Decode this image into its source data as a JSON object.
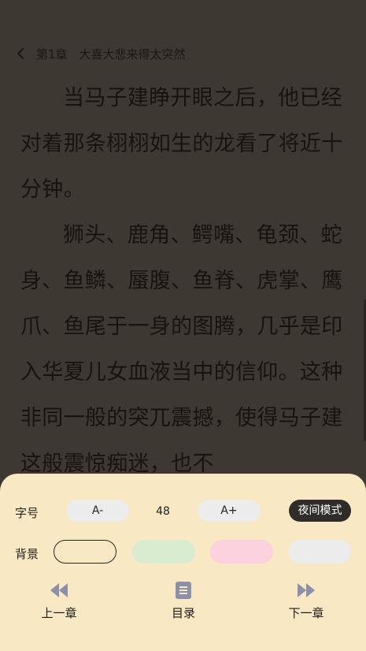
{
  "header": {
    "chapter_title": "第1章　大喜大悲来得太突然"
  },
  "content": {
    "paragraphs": [
      "当马子建睁开眼之后，他已经对着那条栩栩如生的龙看了将近十分钟。",
      "狮头、鹿角、鳄嘴、龟颈、蛇身、鱼鳞、蜃腹、鱼脊、虎掌、鹰爪、鱼尾于一身的图腾，几乎是印入华夏儿女血液当中的信仰。这种非同一般的突兀震撼，使得马子建这般震惊痴迷，也不"
    ]
  },
  "settings": {
    "font_size_label": "字号",
    "decrease_label": "A-",
    "font_size_value": "48",
    "increase_label": "A+",
    "night_mode_label": "夜间模式",
    "background_label": "背景",
    "background_swatches": [
      {
        "name": "cream",
        "color": "#f8e8c3",
        "selected": true
      },
      {
        "name": "green",
        "color": "#d9eccf",
        "selected": false
      },
      {
        "name": "pink",
        "color": "#fcd2de",
        "selected": false
      },
      {
        "name": "gray",
        "color": "#ececec",
        "selected": false
      }
    ]
  },
  "nav": {
    "prev_label": "上一章",
    "toc_label": "目录",
    "next_label": "下一章",
    "icon_color": "#8c90a8"
  },
  "colors": {
    "page_background": "#3d3832",
    "panel_background": "#f8e8c3",
    "night_button": "#2f2c2a"
  }
}
